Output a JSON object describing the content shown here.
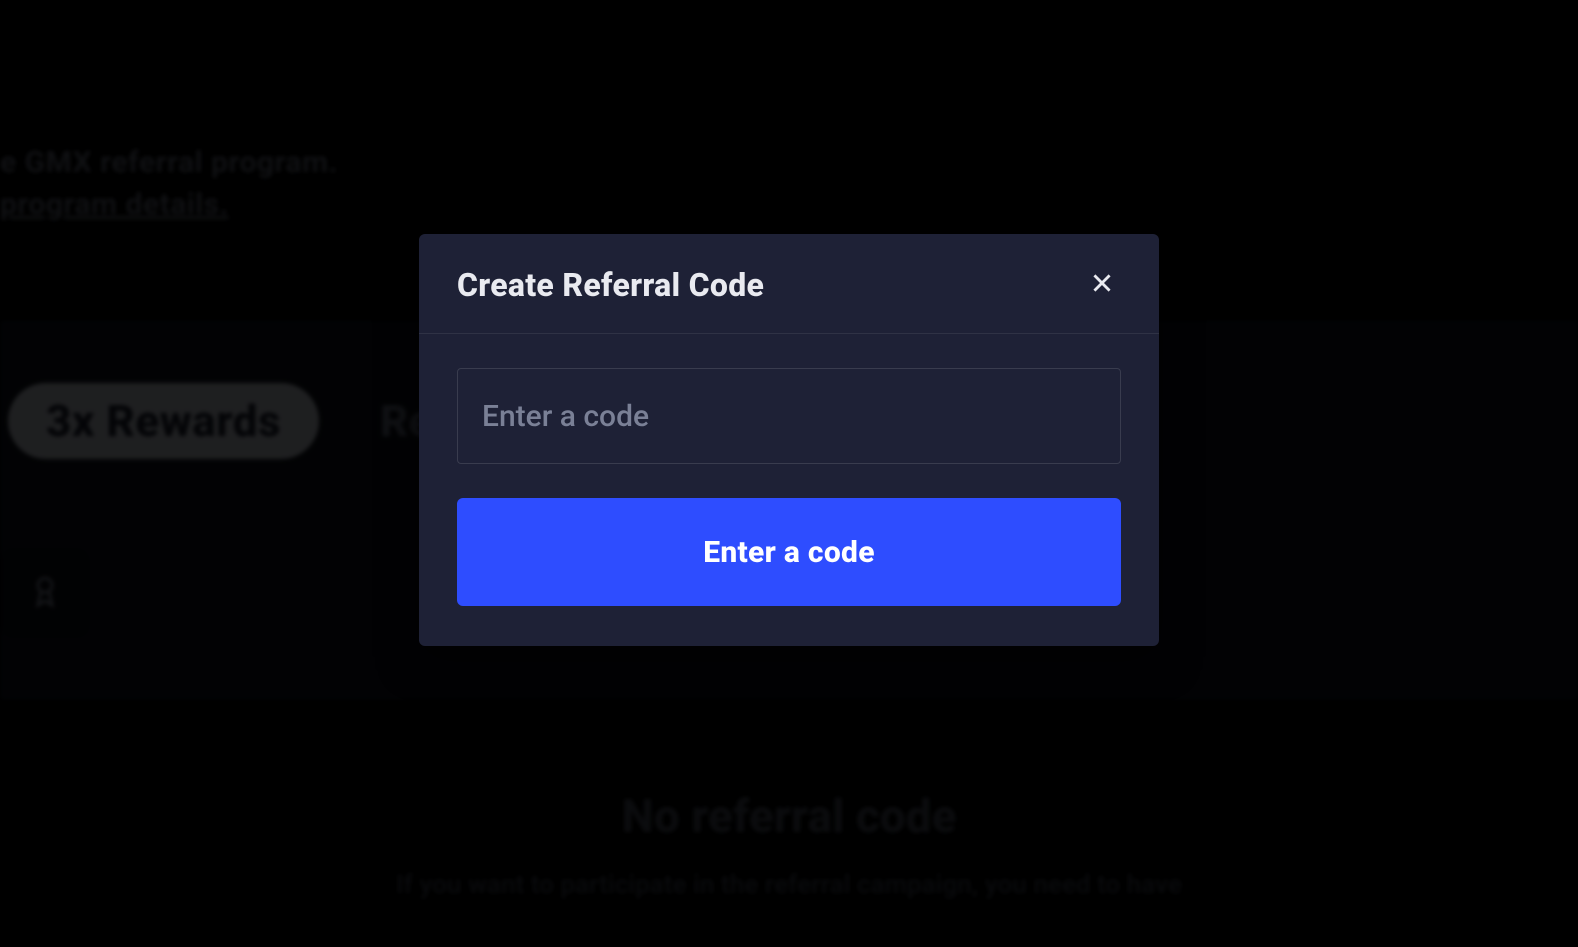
{
  "background": {
    "hero_fragment": "e GMX referral program.",
    "hero_link_fragment": "program details.",
    "pill_label": "3x Rewards",
    "pill_secondary_fragment": "Ret",
    "empty_title": "No referral code",
    "empty_desc_fragment": "If you want to participate in the referral campaign, you need to have"
  },
  "modal": {
    "title": "Create Referral Code",
    "input_placeholder": "Enter a code",
    "submit_label": "Enter a code"
  }
}
